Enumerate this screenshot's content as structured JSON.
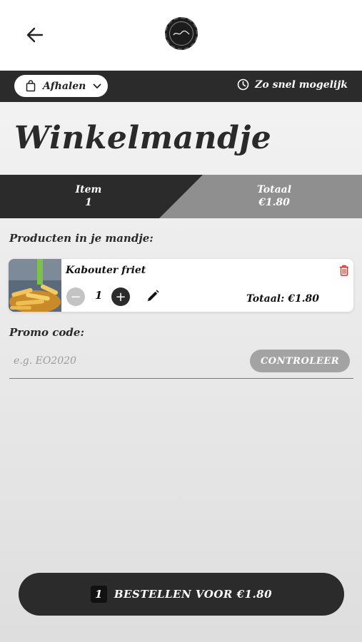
{
  "header": {
    "back_icon": "arrow-left-icon",
    "logo_icon": "restaurant-logo"
  },
  "mode_bar": {
    "pickup_label": "Afhalen",
    "pickup_icon": "shopping-bag-icon",
    "dropdown_icon": "chevron-down-icon",
    "time_icon": "clock-icon",
    "time_label": "Zo snel mogelijk"
  },
  "page_title": "Winkelmandje",
  "summary": {
    "items_label": "Item",
    "items_value": "1",
    "total_label": "Totaal",
    "total_value": "€1.80"
  },
  "products": {
    "section_label": "Producten in je mandje:",
    "items": [
      {
        "name": "Kabouter friet",
        "quantity": "1",
        "total_text": "Totaal: €1.80",
        "image": "fries-photo"
      }
    ],
    "minus_label": "−",
    "plus_label": "+"
  },
  "promo": {
    "label": "Promo code:",
    "placeholder": "e.g. EO2020",
    "check_label": "CONTROLEER"
  },
  "order": {
    "count": "1",
    "label": "BESTELLEN VOOR €1.80"
  },
  "colors": {
    "dark": "#2b2b2b",
    "grey": "#8f8f8f",
    "delete": "#d9342b"
  }
}
